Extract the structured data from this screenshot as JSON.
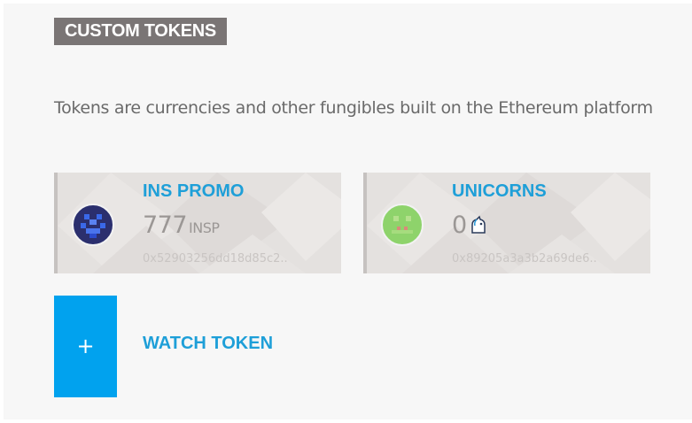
{
  "section": {
    "title": "CUSTOM TOKENS",
    "description": "Tokens are currencies and other fungibles built on the Ethereum platform"
  },
  "tokens": [
    {
      "name": "INS PROMO",
      "balance": "777",
      "symbol": "INSP",
      "address": "0x52903256dd18d85c2..",
      "icon": "pixel-avatar-icon",
      "icon_color": "#2b4bcc"
    },
    {
      "name": "UNICORNS",
      "balance": "0",
      "symbol": "",
      "address": "0x89205a3a3b2a69de6..",
      "icon": "pixel-avatar-icon",
      "icon_color": "#8ed36b",
      "symbol_icon": "unicorn-icon"
    }
  ],
  "watch": {
    "button_symbol": "+",
    "label": "WATCH TOKEN"
  },
  "colors": {
    "accent": "#01a2ee",
    "link": "#1e9fd8",
    "title_bg": "#7a7575"
  }
}
